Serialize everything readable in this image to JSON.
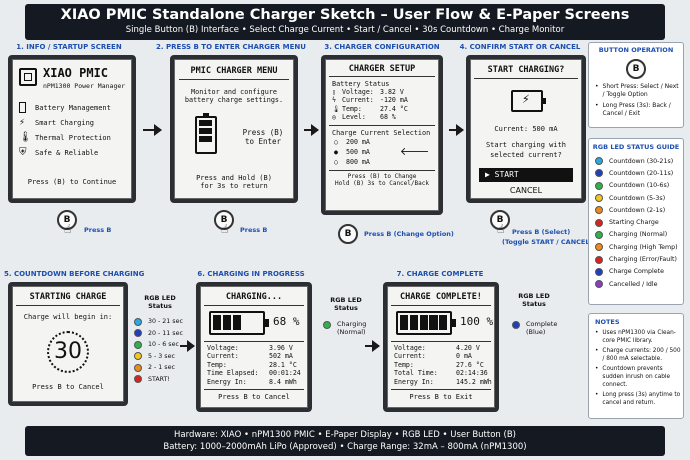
{
  "header": {
    "title": "XIAO PMIC Standalone Charger Sketch – User Flow & E-Paper Screens",
    "subtitle": "Single Button (B) Interface   •   Select Charge Current   •   Start / Cancel   •   30s Countdown   •   Charge Monitor"
  },
  "steps": {
    "s1": "1. INFO / STARTUP SCREEN",
    "s2": "2. PRESS B TO ENTER CHARGER MENU",
    "s3": "3. CHARGER CONFIGURATION",
    "s4": "4. CONFIRM START OR CANCEL",
    "s5": "5. COUNTDOWN BEFORE CHARGING",
    "s6": "6. CHARGING IN PROGRESS",
    "s7": "7. CHARGE COMPLETE"
  },
  "screen1": {
    "title": "XIAO PMIC",
    "subtitle": "nPM1300 Power Manager",
    "items": [
      "Battery Management",
      "Smart Charging",
      "Thermal Protection",
      "Safe & Reliable"
    ],
    "footer": "Press (B) to Continue"
  },
  "screen2": {
    "title": "PMIC CHARGER MENU",
    "desc1": "Monitor and configure",
    "desc2": "battery charge settings.",
    "press1": "Press (B)",
    "press2": "to Enter",
    "hold1": "Press and Hold (B)",
    "hold2": "for 3s to return"
  },
  "screen3": {
    "title": "CHARGER SETUP",
    "status_heading": "Battery Status",
    "status": [
      {
        "k": "Voltage:",
        "v": "3.82 V"
      },
      {
        "k": "Current:",
        "v": "-120 mA"
      },
      {
        "k": "Temp:",
        "v": "27.4 °C"
      },
      {
        "k": "Level:",
        "v": "68 %"
      }
    ],
    "sel_heading": "Charge Current Selection",
    "options": [
      "200 mA",
      "500 mA",
      "800 mA"
    ],
    "footer1": "Press (B) to Change",
    "footer2": "Hold (B) 3s to Cancel/Back"
  },
  "screen4": {
    "title": "START CHARGING?",
    "current": "Current: 500 mA",
    "q1": "Start charging with",
    "q2": "selected current?",
    "start": "▶ START",
    "cancel": "CANCEL"
  },
  "screen5": {
    "title": "STARTING CHARGE",
    "begin": "Charge will begin in:",
    "count": "30",
    "cancel": "Press B to Cancel"
  },
  "screen6": {
    "title": "CHARGING...",
    "percent": "68 %",
    "level_fraction": 0.68,
    "rows": [
      {
        "k": "Voltage:",
        "v": "3.96 V"
      },
      {
        "k": "Current:",
        "v": "502 mA"
      },
      {
        "k": "Temp:",
        "v": "28.1 °C"
      },
      {
        "k": "Time Elapsed:",
        "v": "00:01:24"
      },
      {
        "k": "Energy In:",
        "v": "8.4 mWh"
      }
    ],
    "cancel": "Press B to Cancel"
  },
  "screen7": {
    "title": "CHARGE COMPLETE!",
    "percent": "100 %",
    "level_fraction": 1.0,
    "rows": [
      {
        "k": "Voltage:",
        "v": "4.20 V"
      },
      {
        "k": "Current:",
        "v": "0 mA"
      },
      {
        "k": "Temp:",
        "v": "27.6 °C"
      },
      {
        "k": "Total Time:",
        "v": "02:14:36"
      },
      {
        "k": "Energy In:",
        "v": "145.2 mWh"
      }
    ],
    "exit": "Press B to Exit"
  },
  "buttons": {
    "glyph": "B",
    "b1": "Press B",
    "b2": "Press B",
    "b3": "Press B (Change Option)",
    "b4a": "Press B (Select)",
    "b4b": "(Toggle START / CANCEL)"
  },
  "countdown_led": {
    "title1": "RGB LED",
    "title2": "Status",
    "rows": [
      {
        "label": "30 - 21 sec",
        "color": "#2aa8e0"
      },
      {
        "label": "20 - 11 sec",
        "color": "#1f3fbf"
      },
      {
        "label": "10 - 6 sec",
        "color": "#2eb34a"
      },
      {
        "label": "5 - 3 sec",
        "color": "#f2c81f"
      },
      {
        "label": "2 - 1 sec",
        "color": "#f08a1c"
      },
      {
        "label": "START!",
        "color": "#d9241c"
      }
    ]
  },
  "charging_led": {
    "title1": "RGB LED",
    "title2": "Status",
    "label1": "Charging",
    "label2": "(Normal)",
    "color": "#2eb34a"
  },
  "complete_led": {
    "title1": "RGB LED",
    "title2": "Status",
    "label1": "Complete",
    "label2": "(Blue)",
    "color": "#1f3fbf"
  },
  "button_op": {
    "title": "BUTTON OPERATION",
    "short": "Short Press: Select / Next / Toggle Option",
    "long": "Long Press (3s): Back / Cancel / Exit"
  },
  "led_guide": {
    "title": "RGB LED STATUS GUIDE",
    "rows": [
      {
        "label": "Countdown (30-21s)",
        "color": "#2aa8e0"
      },
      {
        "label": "Countdown (20-11s)",
        "color": "#1f3fbf"
      },
      {
        "label": "Countdown (10-6s)",
        "color": "#2eb34a"
      },
      {
        "label": "Countdown (5-3s)",
        "color": "#f2c81f"
      },
      {
        "label": "Countdown (2-1s)",
        "color": "#f08a1c"
      },
      {
        "label": "Starting Charge",
        "color": "#d9241c"
      },
      {
        "label": "Charging (Normal)",
        "color": "#2eb34a"
      },
      {
        "label": "Charging (High Temp)",
        "color": "#f08a1c"
      },
      {
        "label": "Charging (Error/Fault)",
        "color": "#d9241c"
      },
      {
        "label": "Charge Complete",
        "color": "#1f3fbf"
      },
      {
        "label": "Cancelled / Idle",
        "color": "#8a3fbf"
      }
    ]
  },
  "notes": {
    "title": "NOTES",
    "items": [
      "Uses nPM1300 via Clean-core PMIC library.",
      "Charge currents: 200 / 500 / 800 mA selectable.",
      "Countdown prevents sudden inrush on cable connect.",
      "Long press (3s) anytime to cancel and return."
    ]
  },
  "footer": {
    "line1": "Hardware: XIAO  •  nPM1300 PMIC  •  E-Paper Display  •  RGB LED  •  User Button (B)",
    "line2": "Battery: 1000–2000mAh LiPo (Approved)   •   Charge Range: 32mA – 800mA (nPM1300)"
  }
}
